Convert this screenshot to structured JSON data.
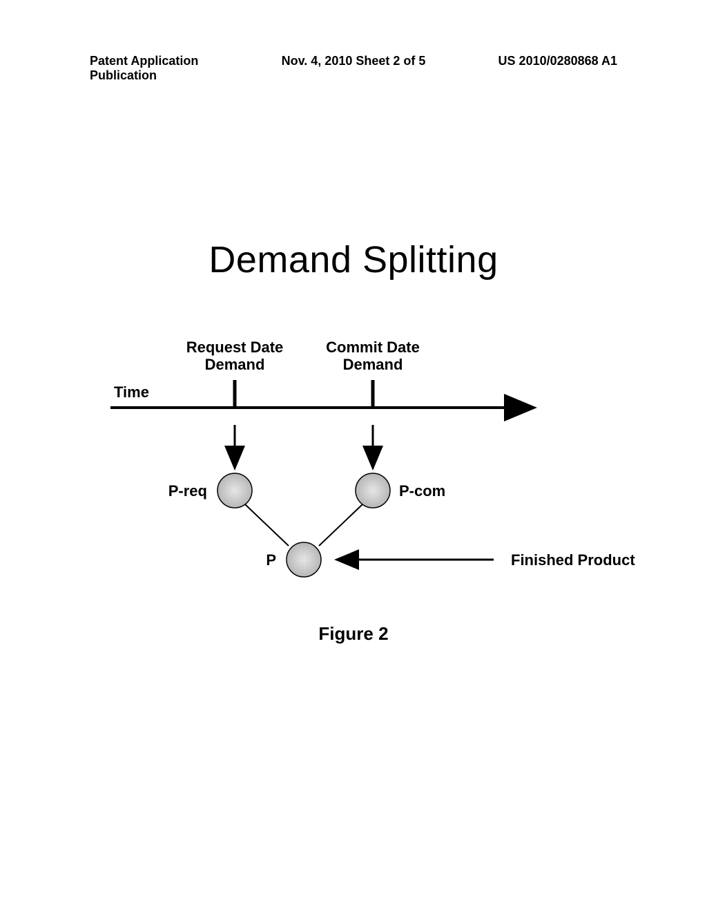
{
  "header": {
    "left": "Patent Application Publication",
    "center": "Nov. 4, 2010  Sheet 2 of 5",
    "right": "US 2010/0280868 A1"
  },
  "title": "Demand Splitting",
  "diagram": {
    "time_label": "Time",
    "request_label_line1": "Request Date",
    "request_label_line2": "Demand",
    "commit_label_line1": "Commit Date",
    "commit_label_line2": "Demand",
    "p_req_label": "P-req",
    "p_com_label": "P-com",
    "p_label": "P",
    "finished_product_label": "Finished Product"
  },
  "figure_caption": "Figure 2"
}
